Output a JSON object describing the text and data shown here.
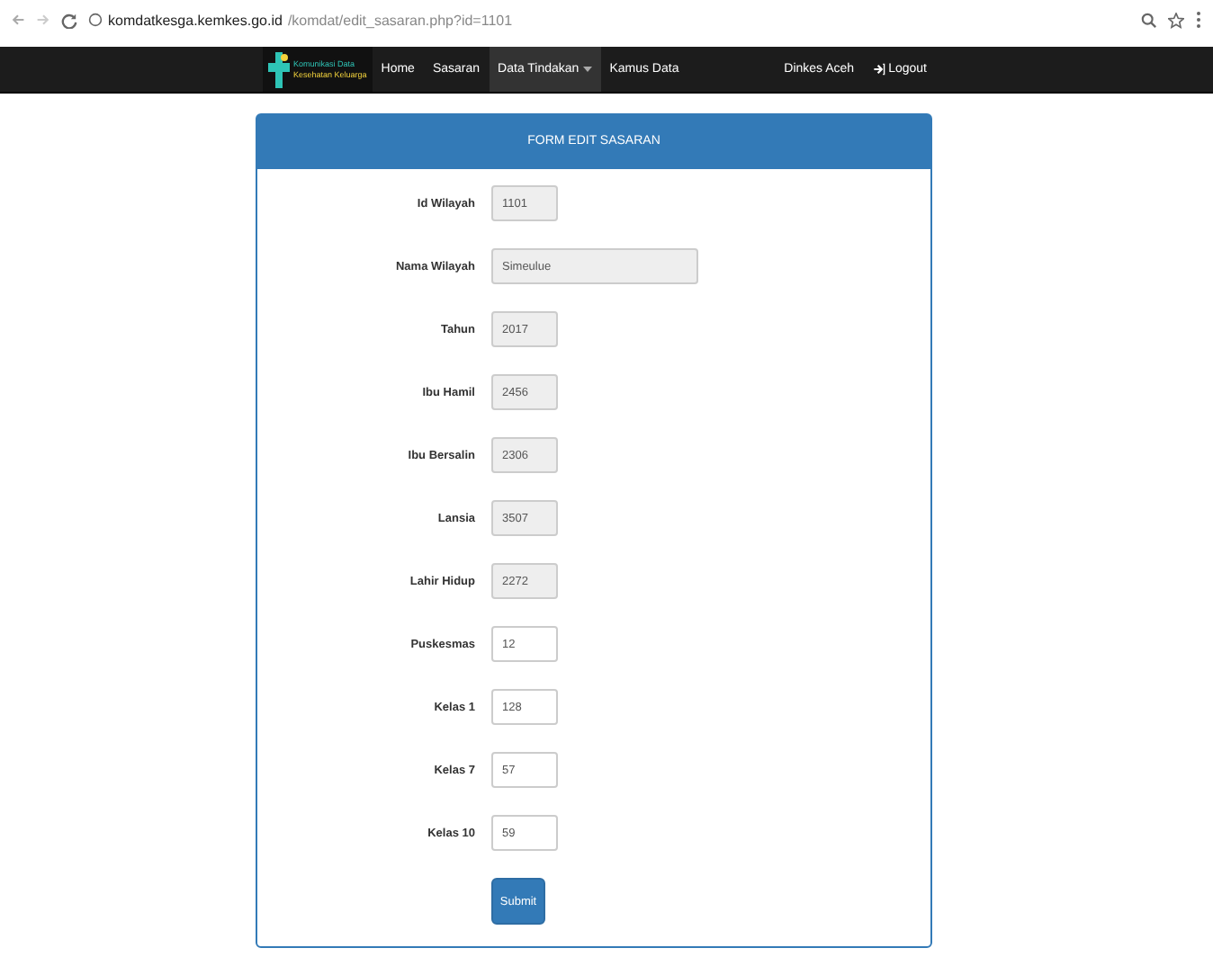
{
  "browser": {
    "url_host": "komdatkesga.kemkes.go.id",
    "url_path": "/komdat/edit_sasaran.php?id=1101"
  },
  "navbar": {
    "logo_lines": [
      "Komunikasi Data",
      "Kesehatan Keluarga"
    ],
    "items": [
      {
        "label": "Home",
        "selected": false,
        "dropdown": false
      },
      {
        "label": "Sasaran",
        "selected": false,
        "dropdown": false
      },
      {
        "label": "Data Tindakan",
        "selected": true,
        "dropdown": true
      },
      {
        "label": "Kamus Data",
        "selected": false,
        "dropdown": false
      }
    ],
    "user": "Dinkes Aceh",
    "logout": "Logout"
  },
  "form": {
    "title": "FORM EDIT SASARAN",
    "fields": [
      {
        "label": "Id Wilayah",
        "value": "1101",
        "disabled": true,
        "wide": false
      },
      {
        "label": "Nama Wilayah",
        "value": "Simeulue",
        "disabled": true,
        "wide": true
      },
      {
        "label": "Tahun",
        "value": "2017",
        "disabled": true,
        "wide": false
      },
      {
        "label": "Ibu Hamil",
        "value": "2456",
        "disabled": true,
        "wide": false
      },
      {
        "label": "Ibu Bersalin",
        "value": "2306",
        "disabled": true,
        "wide": false
      },
      {
        "label": "Lansia",
        "value": "3507",
        "disabled": true,
        "wide": false
      },
      {
        "label": "Lahir Hidup",
        "value": "2272",
        "disabled": true,
        "wide": false
      },
      {
        "label": "Puskesmas",
        "value": "12",
        "disabled": false,
        "wide": false
      },
      {
        "label": "Kelas 1",
        "value": "128",
        "disabled": false,
        "wide": false
      },
      {
        "label": "Kelas 7",
        "value": "57",
        "disabled": false,
        "wide": false
      },
      {
        "label": "Kelas 10",
        "value": "59",
        "disabled": false,
        "wide": false
      }
    ],
    "submit": "Submit"
  }
}
